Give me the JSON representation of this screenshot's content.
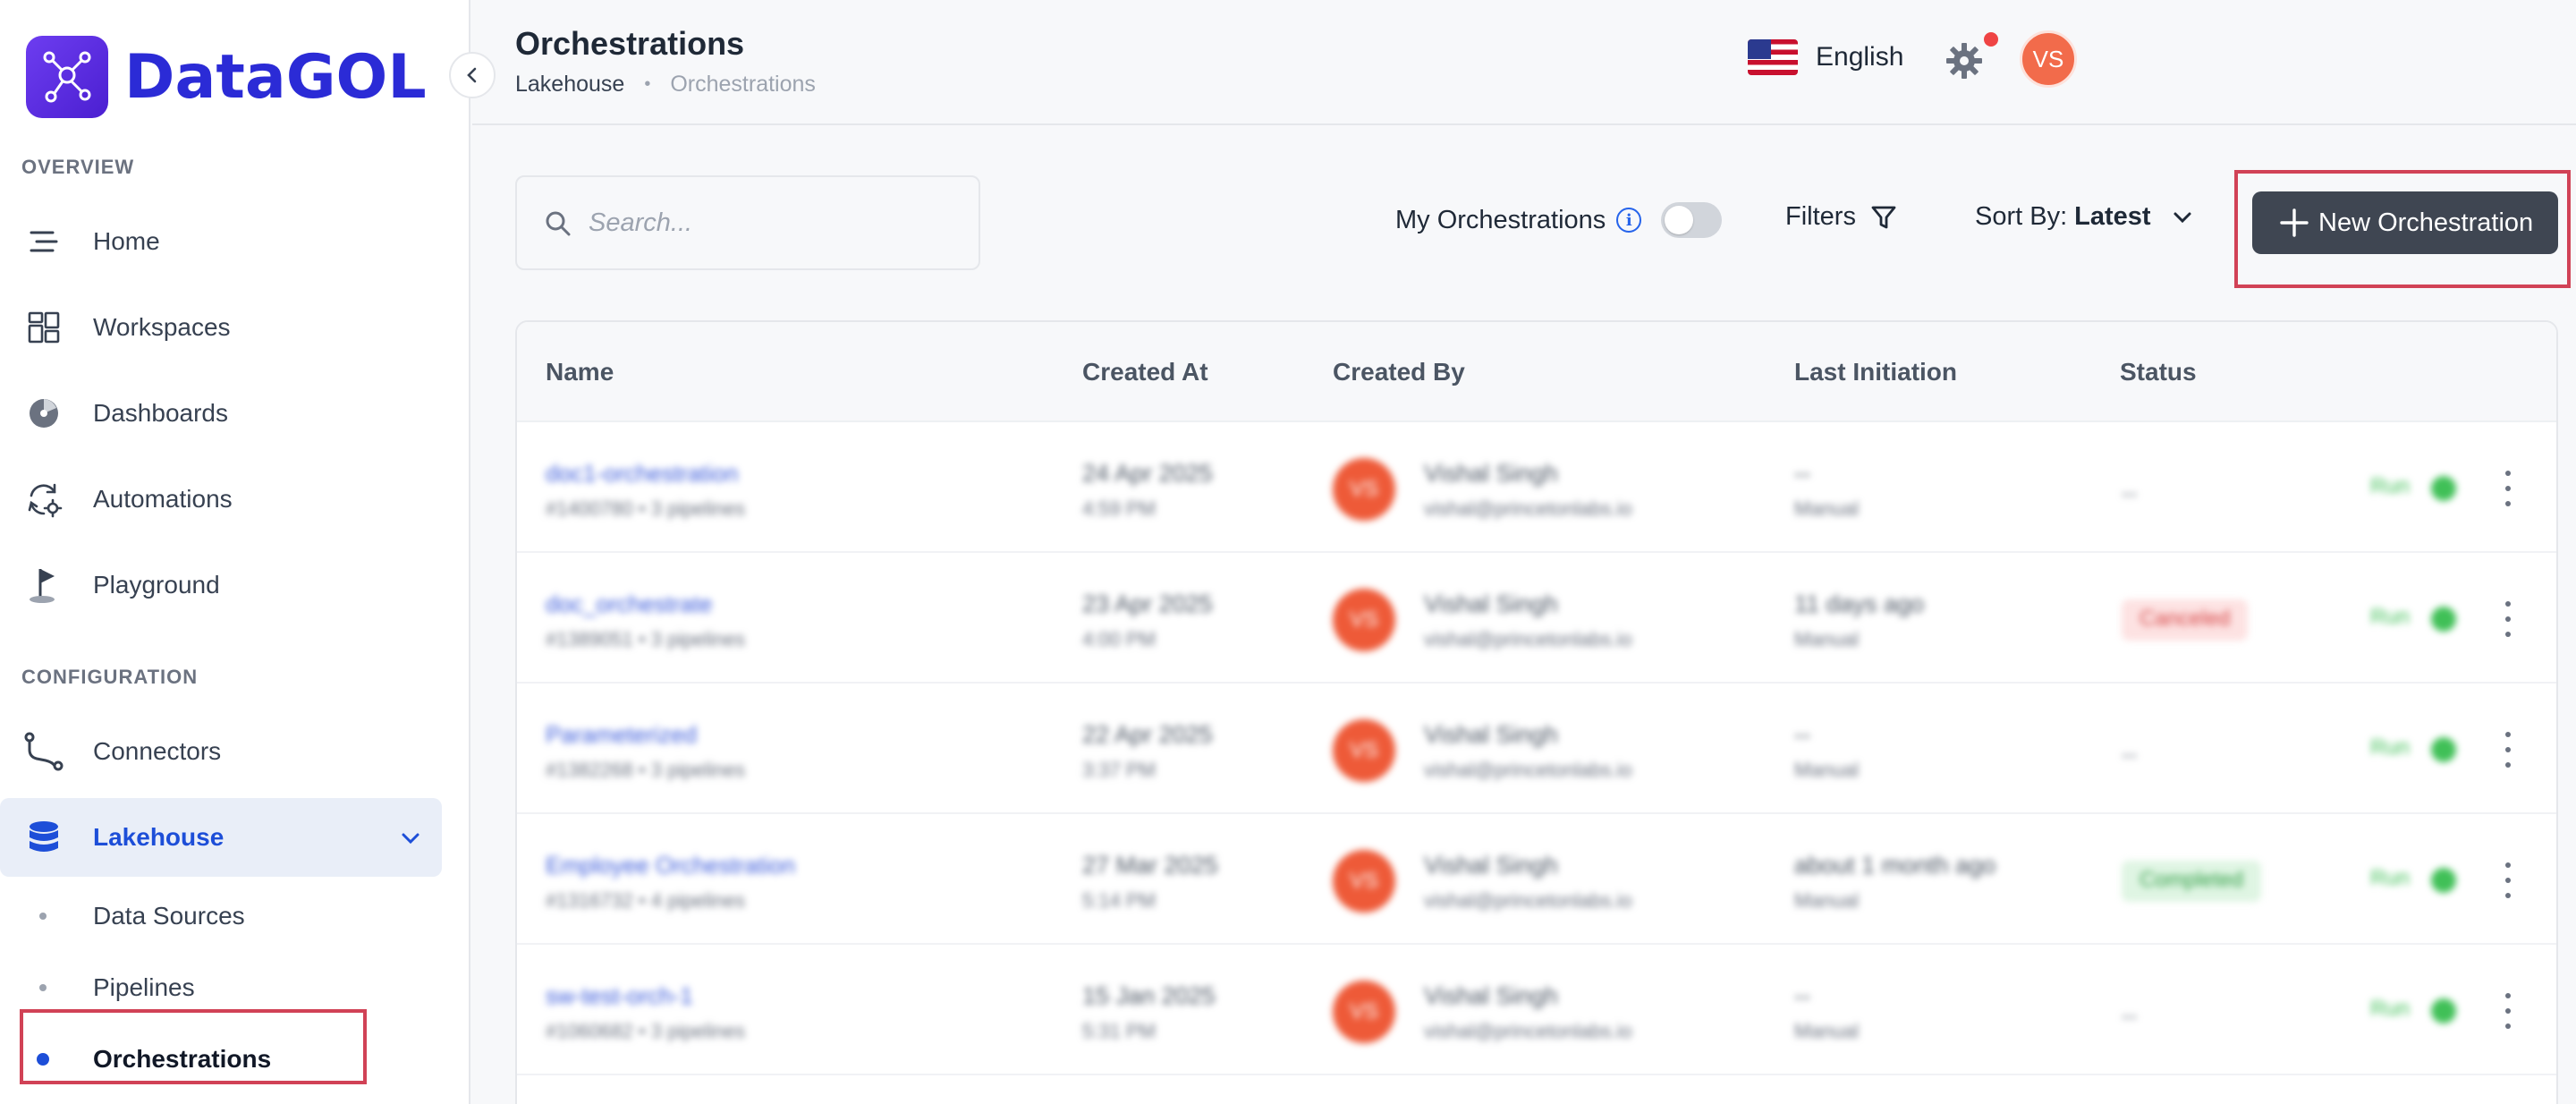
{
  "brand": {
    "name": "DataGOL"
  },
  "sidebar": {
    "overview_label": "OVERVIEW",
    "configuration_label": "CONFIGURATION",
    "overview_items": [
      {
        "label": "Home",
        "icon": "home-icon"
      },
      {
        "label": "Workspaces",
        "icon": "workspaces-icon"
      },
      {
        "label": "Dashboards",
        "icon": "dashboards-icon"
      },
      {
        "label": "Automations",
        "icon": "automations-icon"
      },
      {
        "label": "Playground",
        "icon": "playground-icon"
      }
    ],
    "config_items": [
      {
        "label": "Connectors",
        "icon": "connectors-icon"
      },
      {
        "label": "Lakehouse",
        "icon": "database-icon",
        "expanded": true
      }
    ],
    "lakehouse_sub_items": [
      {
        "label": "Data Sources"
      },
      {
        "label": "Pipelines"
      },
      {
        "label": "Orchestrations",
        "active": true
      }
    ]
  },
  "header": {
    "title": "Orchestrations",
    "breadcrumb": [
      "Lakehouse",
      "Orchestrations"
    ],
    "language": "English",
    "user_initials": "VS"
  },
  "toolbar": {
    "search_placeholder": "Search...",
    "my_orchestrations_label": "My Orchestrations",
    "my_orchestrations_on": false,
    "filters_label": "Filters",
    "sort_label": "Sort By:",
    "sort_value": "Latest",
    "new_button_label": "New Orchestration"
  },
  "table": {
    "columns": [
      "Name",
      "Created At",
      "Created By",
      "Last Initiation",
      "Status"
    ],
    "rows": [
      {
        "name": "doc1-orchestration",
        "meta": "#1400780 • 3 pipelines",
        "date": "24 Apr 2025",
        "time": "4:59 PM",
        "initials": "VS",
        "user": "Vishal Singh",
        "email": "vishal@princetonlabs.io",
        "last_initiation": "--",
        "trigger": "Manual",
        "status": "--",
        "run_label": "Run"
      },
      {
        "name": "doc_orchestrate",
        "meta": "#1389051 • 3 pipelines",
        "date": "23 Apr 2025",
        "time": "4:00 PM",
        "initials": "VS",
        "user": "Vishal Singh",
        "email": "vishal@princetonlabs.io",
        "last_initiation": "11 days ago",
        "trigger": "Manual",
        "status": "Canceled",
        "run_label": "Run"
      },
      {
        "name": "Parameterized",
        "meta": "#1382268 • 3 pipelines",
        "date": "22 Apr 2025",
        "time": "3:37 PM",
        "initials": "VS",
        "user": "Vishal Singh",
        "email": "vishal@princetonlabs.io",
        "last_initiation": "--",
        "trigger": "Manual",
        "status": "--",
        "run_label": "Run"
      },
      {
        "name": "Employee Orchestration",
        "meta": "#1316732 • 4 pipelines",
        "date": "27 Mar 2025",
        "time": "5:14 PM",
        "initials": "VS",
        "user": "Vishal Singh",
        "email": "vishal@princetonlabs.io",
        "last_initiation": "about 1 month ago",
        "trigger": "Manual",
        "status": "Completed",
        "run_label": "Run"
      },
      {
        "name": "sw-test-orch-1",
        "meta": "#1060682 • 3 pipelines",
        "date": "15 Jan 2025",
        "time": "5:31 PM",
        "initials": "VS",
        "user": "Vishal Singh",
        "email": "vishal@princetonlabs.io",
        "last_initiation": "--",
        "trigger": "Manual",
        "status": "--",
        "run_label": "Run"
      }
    ]
  },
  "colors": {
    "accent": "#1d4ed8",
    "brand": "#2b2bd6",
    "button": "#3f4652",
    "avatar": "#f26b4b",
    "highlight": "#d14256"
  }
}
